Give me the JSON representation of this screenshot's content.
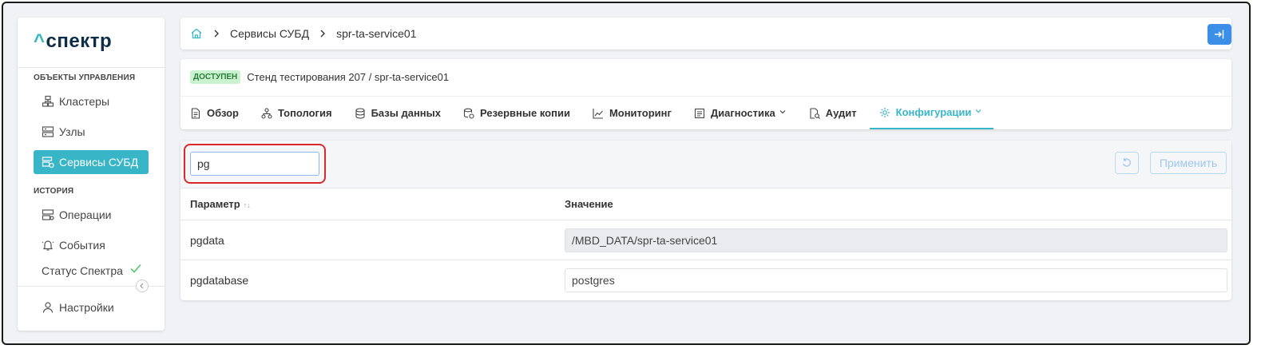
{
  "app": {
    "logo_caret": "^",
    "logo_text": "спектр"
  },
  "sidebar": {
    "section_objects": "ОБЪЕКТЫ УПРАВЛЕНИЯ",
    "section_history": "ИСТОРИЯ",
    "items": [
      {
        "label": "Кластеры",
        "icon": "cluster-icon"
      },
      {
        "label": "Узлы",
        "icon": "server-icon"
      },
      {
        "label": "Сервисы СУБД",
        "icon": "database-service-icon"
      },
      {
        "label": "Операции",
        "icon": "operations-icon"
      },
      {
        "label": "События",
        "icon": "events-icon"
      },
      {
        "label": "Настройки",
        "icon": "user-icon"
      }
    ],
    "status_label": "Статус Спектра",
    "accent": "#38b6c7"
  },
  "breadcrumb": {
    "items": [
      "Сервисы СУБД",
      "spr-ta-service01"
    ]
  },
  "service": {
    "status_badge": "ДОСТУПЕН",
    "title": "Стенд тестирования 207 /  spr-ta-service01",
    "tabs": [
      {
        "label": "Обзор",
        "icon": "document-icon"
      },
      {
        "label": "Топология",
        "icon": "topology-icon"
      },
      {
        "label": "Базы данных",
        "icon": "database-icon"
      },
      {
        "label": "Резервные копии",
        "icon": "backup-icon"
      },
      {
        "label": "Мониторинг",
        "icon": "chart-icon"
      },
      {
        "label": "Диагностика",
        "icon": "diagnostics-icon"
      },
      {
        "label": "Аудит",
        "icon": "audit-icon"
      },
      {
        "label": "Конфигурации",
        "icon": "gear-icon"
      }
    ]
  },
  "config": {
    "search_value": "pg",
    "apply_label": "Применить",
    "col_param": "Параметр",
    "col_value": "Значение",
    "rows": [
      {
        "name": "pgdata",
        "value": "/MBD_DATA/spr-ta-service01"
      },
      {
        "name": "pgdatabase",
        "value": "postgres"
      }
    ]
  }
}
